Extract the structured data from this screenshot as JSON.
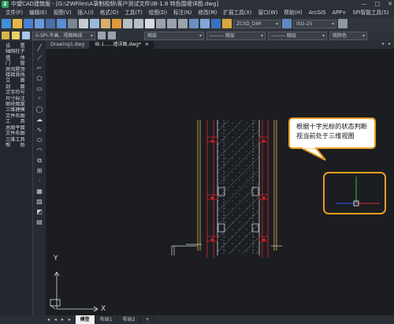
{
  "window": {
    "title": "中望CAD建筑版 - [G:\\ZWFiles\\A录制视频\\客户测试文件\\IB-1.8 特色围墙详图.dwg]",
    "controls": [
      "—",
      "□",
      "✕"
    ]
  },
  "menu": {
    "items": [
      "文件(F)",
      "编辑(E)",
      "视图(V)",
      "插入(I)",
      "格式(O)",
      "工具(T)",
      "绘图(D)",
      "标注(N)",
      "修改(M)",
      "扩展工具(X)",
      "窗口(W)",
      "帮助(H)",
      "ArcGIS",
      "APP+",
      "SPI智能工具(S)"
    ],
    "right": "— □ ✕"
  },
  "toolbar1": {
    "style_combo": "ZCSD_DIM",
    "dim_combo": "ISO-25"
  },
  "toolbar2": {
    "layer_combo": "0-SPI-不画、视图框线",
    "color_combo": "随层",
    "linetype_combo": "——— 随层",
    "lineweight_combo": "——— 随层",
    "plot_combo": "随颜色"
  },
  "left_panel": {
    "items": [
      "设　　置",
      "轴网柱子",
      "墙　　体",
      "门　　窗",
      "房间屋顶",
      "楼梯其他",
      "立　　面",
      "剖　　面",
      "文字符号",
      "尺寸标注",
      "图块图案",
      "三维建模",
      "文件布图",
      "工　　具",
      "总图平面",
      "文件布图",
      "三维工具",
      "帮　　助"
    ]
  },
  "doc_tabs": {
    "tabs": [
      "Drawing1.dwg",
      "IB-1......墙详图.dwg*"
    ],
    "close": "✕",
    "nav": "◂ ▸"
  },
  "callout": {
    "text": "根据十字光标的状态判断视当前处于三维视图"
  },
  "ucs": {
    "x_label": "X",
    "y_label": "Y"
  },
  "bottom_tabs": {
    "nav": "◂ ◂ ▸ ▸",
    "tabs": [
      "模型",
      "布局1",
      "布局2"
    ],
    "add": "+"
  },
  "colors": {
    "accent_orange": "#e59d21",
    "wall_red": "#e0232a",
    "wall_yellow": "#e6b84a",
    "hatch_white": "#cfd4da",
    "cursor_green": "#2dbf3c",
    "cursor_red": "#d82b2b",
    "cursor_blue": "#2a4cff"
  }
}
